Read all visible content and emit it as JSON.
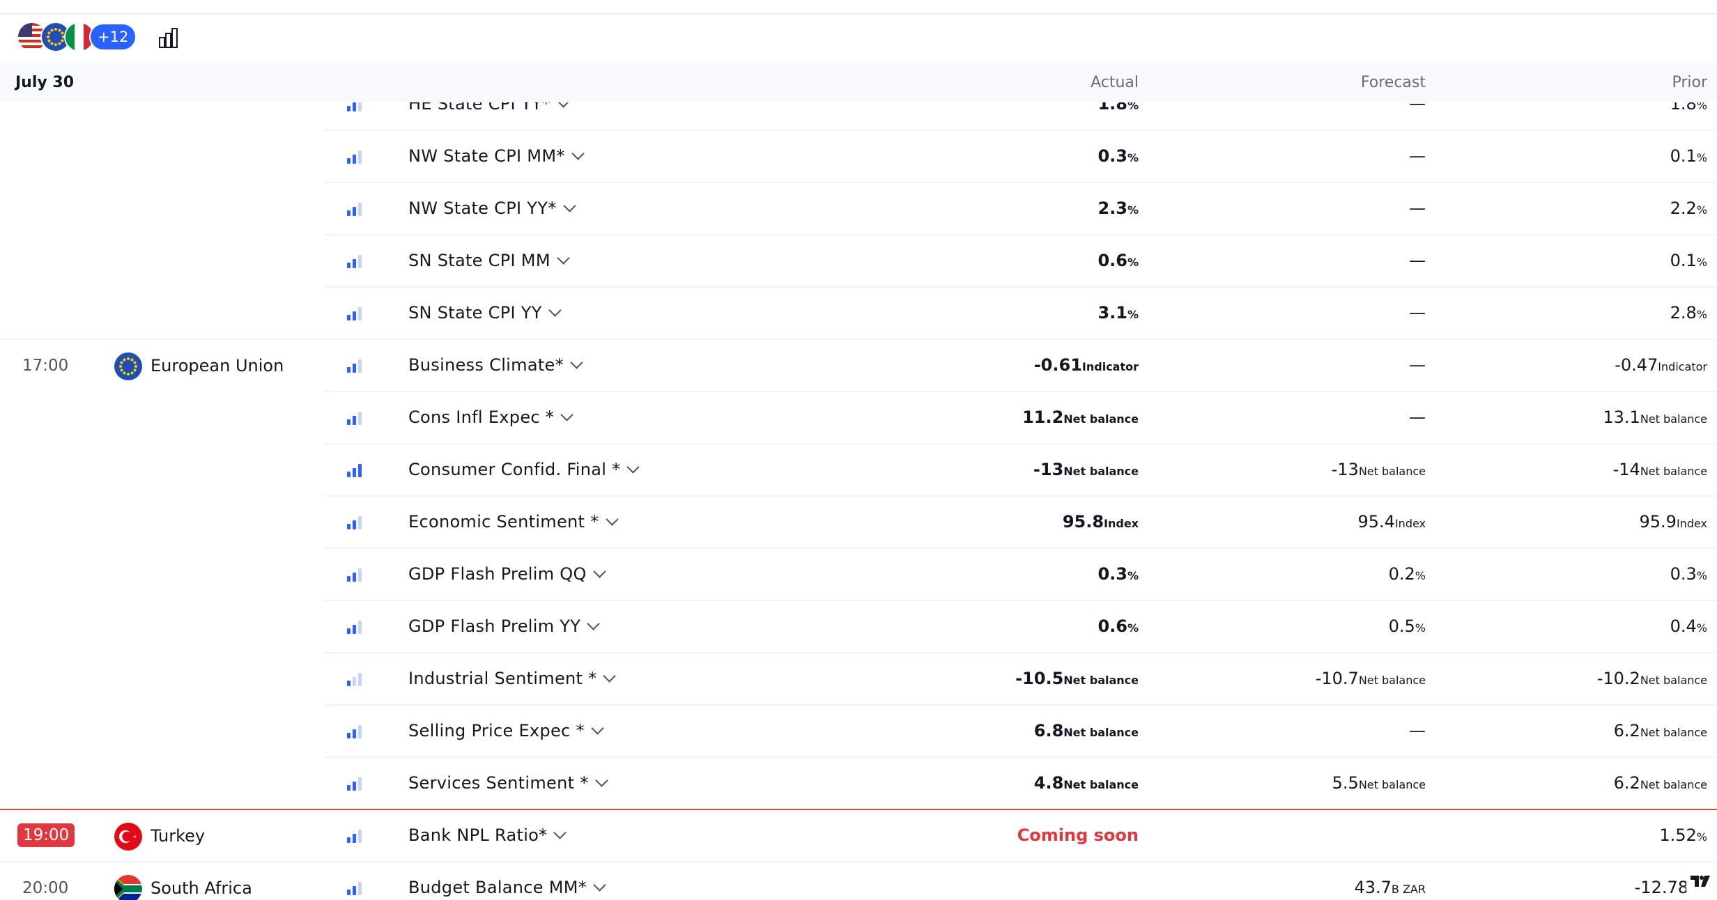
{
  "toolbar": {
    "more_countries": "+12"
  },
  "header": {
    "date": "July 30",
    "actual": "Actual",
    "forecast": "Forecast",
    "prior": "Prior"
  },
  "rows": [
    {
      "time": "",
      "country": "",
      "event": "HE State CPI YY*",
      "actual": "1.8",
      "actual_unit": "%",
      "forecast": "—",
      "forecast_unit": "",
      "prior": "1.8",
      "prior_unit": "%",
      "importance": 2
    },
    {
      "time": "",
      "country": "",
      "event": "NW State CPI MM*",
      "actual": "0.3",
      "actual_unit": "%",
      "forecast": "—",
      "forecast_unit": "",
      "prior": "0.1",
      "prior_unit": "%",
      "importance": 2
    },
    {
      "time": "",
      "country": "",
      "event": "NW State CPI YY*",
      "actual": "2.3",
      "actual_unit": "%",
      "forecast": "—",
      "forecast_unit": "",
      "prior": "2.2",
      "prior_unit": "%",
      "importance": 2
    },
    {
      "time": "",
      "country": "",
      "event": "SN State CPI MM",
      "actual": "0.6",
      "actual_unit": "%",
      "forecast": "—",
      "forecast_unit": "",
      "prior": "0.1",
      "prior_unit": "%",
      "importance": 2
    },
    {
      "time": "",
      "country": "",
      "event": "SN State CPI YY",
      "actual": "3.1",
      "actual_unit": "%",
      "forecast": "—",
      "forecast_unit": "",
      "prior": "2.8",
      "prior_unit": "%",
      "importance": 2
    },
    {
      "time": "17:00",
      "country": "European Union",
      "event": "Business Climate*",
      "actual": "-0.61",
      "actual_unit": "Indicator",
      "forecast": "—",
      "forecast_unit": "",
      "prior": "-0.47",
      "prior_unit": "Indicator",
      "importance": 2
    },
    {
      "time": "",
      "country": "",
      "event": "Cons Infl Expec *",
      "actual": "11.2",
      "actual_unit": "Net balance",
      "forecast": "—",
      "forecast_unit": "",
      "prior": "13.1",
      "prior_unit": "Net balance",
      "importance": 2
    },
    {
      "time": "",
      "country": "",
      "event": "Consumer Confid. Final *",
      "actual": "-13",
      "actual_unit": "Net balance",
      "forecast": "-13",
      "forecast_unit": "Net balance",
      "prior": "-14",
      "prior_unit": "Net balance",
      "importance": 3
    },
    {
      "time": "",
      "country": "",
      "event": "Economic Sentiment *",
      "actual": "95.8",
      "actual_unit": "Index",
      "forecast": "95.4",
      "forecast_unit": "Index",
      "prior": "95.9",
      "prior_unit": "Index",
      "importance": 2
    },
    {
      "time": "",
      "country": "",
      "event": "GDP Flash Prelim QQ",
      "actual": "0.3",
      "actual_unit": "%",
      "forecast": "0.2",
      "forecast_unit": "%",
      "prior": "0.3",
      "prior_unit": "%",
      "importance": 2
    },
    {
      "time": "",
      "country": "",
      "event": "GDP Flash Prelim YY",
      "actual": "0.6",
      "actual_unit": "%",
      "forecast": "0.5",
      "forecast_unit": "%",
      "prior": "0.4",
      "prior_unit": "%",
      "importance": 2
    },
    {
      "time": "",
      "country": "",
      "event": "Industrial Sentiment *",
      "actual": "-10.5",
      "actual_unit": "Net balance",
      "forecast": "-10.7",
      "forecast_unit": "Net balance",
      "prior": "-10.2",
      "prior_unit": "Net balance",
      "importance": 1
    },
    {
      "time": "",
      "country": "",
      "event": "Selling Price Expec *",
      "actual": "6.8",
      "actual_unit": "Net balance",
      "forecast": "—",
      "forecast_unit": "",
      "prior": "6.2",
      "prior_unit": "Net balance",
      "importance": 2
    },
    {
      "time": "",
      "country": "",
      "event": "Services Sentiment *",
      "actual": "4.8",
      "actual_unit": "Net balance",
      "forecast": "5.5",
      "forecast_unit": "Net balance",
      "prior": "6.2",
      "prior_unit": "Net balance",
      "importance": 2
    },
    {
      "time": "19:00",
      "country": "Turkey",
      "event": "Bank NPL Ratio*",
      "actual": "Coming soon",
      "actual_unit": "",
      "forecast": "",
      "forecast_unit": "",
      "prior": "1.52",
      "prior_unit": "%",
      "importance": 2
    },
    {
      "time": "20:00",
      "country": "South Africa",
      "event": "Budget Balance MM*",
      "actual": "",
      "actual_unit": "",
      "forecast": "43.7",
      "forecast_unit": "B ZAR",
      "prior": "-12.78",
      "prior_unit": "B…",
      "importance": 2
    }
  ],
  "colors": {
    "accent": "#2962ff",
    "live": "#e0383e",
    "importance_off": "#c8d3f5"
  }
}
